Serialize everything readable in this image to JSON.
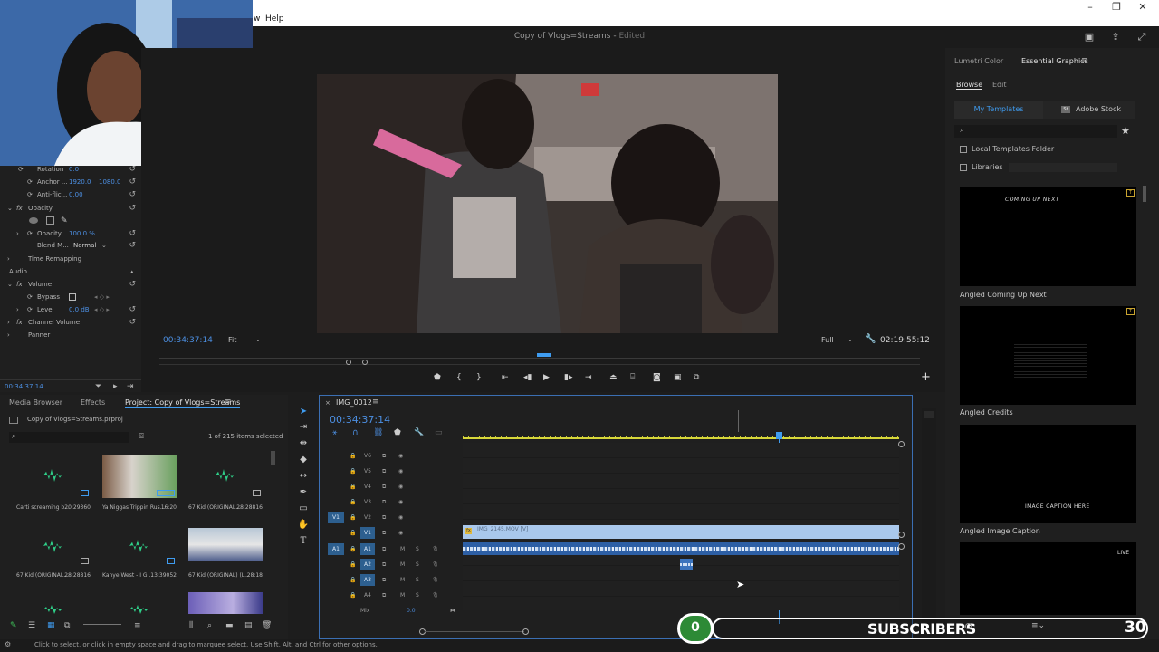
{
  "menubar": {
    "help": "Help",
    "partial": "w"
  },
  "window": {
    "title": "Copy of Vlogs=Streams",
    "status": "Edited"
  },
  "effect_controls": {
    "rows": [
      {
        "label": "Rotation",
        "value": "0.0"
      },
      {
        "label": "Anchor ...",
        "value": "1920.0",
        "value2": "1080.0"
      },
      {
        "label": "Anti-flic...",
        "value": "0.00"
      },
      {
        "label": "Opacity"
      },
      {
        "label": "Opacity",
        "value": "100.0 %"
      },
      {
        "label": "Blend M...",
        "value": "Normal"
      },
      {
        "label": "Time Remapping"
      },
      {
        "label": "Audio"
      },
      {
        "label": "Volume"
      },
      {
        "label": "Bypass"
      },
      {
        "label": "Level",
        "value": "0.0 dB"
      },
      {
        "label": "Channel Volume"
      },
      {
        "label": "Panner"
      }
    ],
    "timecode": "00:34:37:14"
  },
  "program": {
    "timecode": "00:34:37:14",
    "fit": "Fit",
    "quality": "Full",
    "duration": "02:19:55:12"
  },
  "right_panel": {
    "tabs": [
      "Lumetri Color",
      "Essential Graphics"
    ],
    "subtabs": [
      "Browse",
      "Edit"
    ],
    "source_tabs": [
      "My Templates",
      "Adobe Stock"
    ],
    "checkbox_local": "Local Templates Folder",
    "checkbox_libraries": "Libraries",
    "templates": [
      {
        "name": "Angled Coming Up Next",
        "overlay": "COMING UP NEXT"
      },
      {
        "name": "Angled Credits",
        "overlay": ""
      },
      {
        "name": "Angled Image Caption",
        "overlay": "IMAGE CAPTION HERE"
      },
      {
        "name": "",
        "overlay": "LIVE"
      }
    ]
  },
  "project": {
    "tabs": [
      "Media Browser",
      "Effects",
      "Project: Copy of Vlogs=Streams"
    ],
    "file": "Copy of Vlogs=Streams.prproj",
    "selection": "1 of 215 items selected",
    "clips": [
      {
        "name": "Carti screaming b...",
        "dur": "20:29360"
      },
      {
        "name": "Ya Niggas Trippin Rus...",
        "dur": "16:20"
      },
      {
        "name": "67 Kid (ORIGINAL...",
        "dur": "28:28816"
      },
      {
        "name": "67 Kid (ORIGINAL...",
        "dur": "28:28816"
      },
      {
        "name": "Kanye West - I G...",
        "dur": "13:39052"
      },
      {
        "name": "67 Kid (ORIGINAL) (L...",
        "dur": "28:18"
      }
    ]
  },
  "timeline": {
    "sequence": "IMG_0012",
    "timecode": "00:34:37:14",
    "video_tracks": [
      "V6",
      "V5",
      "V4",
      "V3",
      "V2",
      "V1"
    ],
    "audio_tracks": [
      "A1",
      "A2",
      "A3",
      "A4"
    ],
    "source_v": "V1",
    "source_a": "A1",
    "mix_label": "Mix",
    "mix_value": "0.0",
    "clip_label": "IMG_2145.MOV [V]"
  },
  "status_text": "Click to select, or click in empty space and drag to marquee select. Use Shift, Alt, and Ctrl for other options.",
  "subscribers": {
    "count": "0",
    "label": "SUBSCRIBERS",
    "goal": "30"
  },
  "colors": {
    "accent": "#2d8ceb",
    "clip_video": "#a9c8ec",
    "clip_audio": "#2d5fa5",
    "playhead": "#3f9cf0",
    "sub_green": "#38b443"
  }
}
